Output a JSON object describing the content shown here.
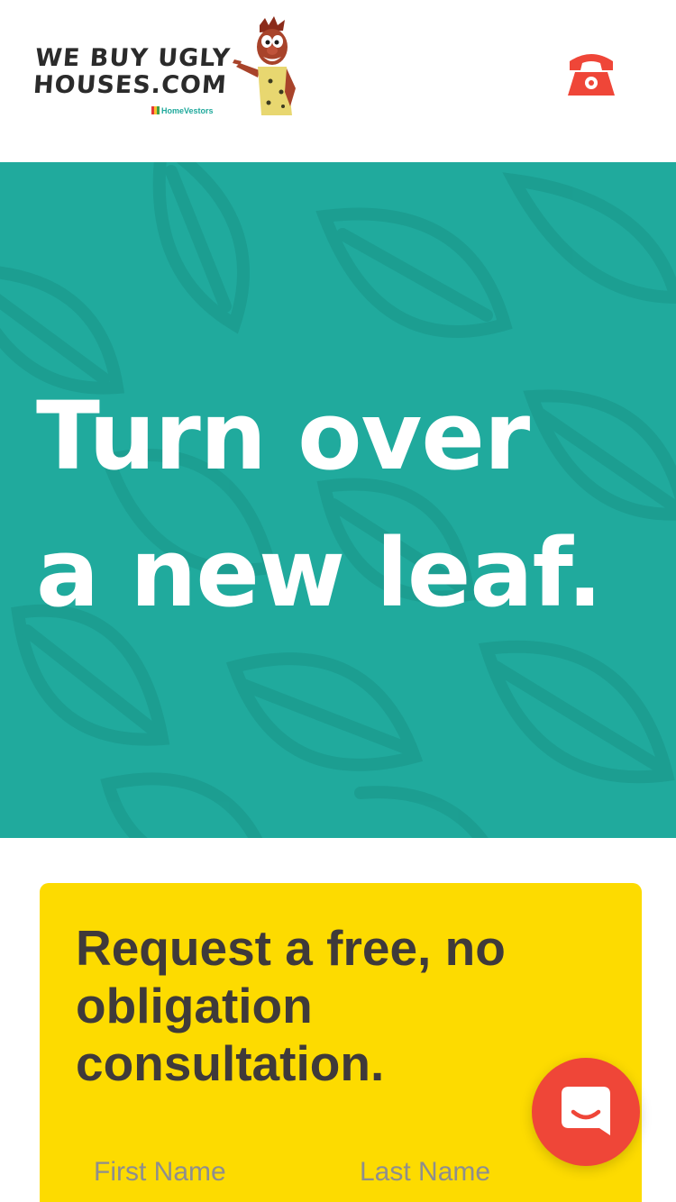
{
  "header": {
    "logo": {
      "line1": "WE BUY UGLY",
      "line2": "HOUSES.COM",
      "sub": "HomeVestors",
      "mascot_icon": "caveman-mascot-icon"
    },
    "phone_icon": "phone-icon",
    "accent_color": "#ef4638"
  },
  "hero": {
    "title_line1": "Turn over",
    "title_line2": "a new leaf.",
    "background_color": "#20aa9d",
    "pattern_icon": "leaf-pattern"
  },
  "form_card": {
    "title": "Request a free, no obligation consultation.",
    "background_color": "#fddb00",
    "first_name_placeholder": "First Name",
    "last_name_placeholder": "Last Name"
  },
  "chat": {
    "icon": "chat-bubble-icon",
    "color": "#ef4638"
  }
}
